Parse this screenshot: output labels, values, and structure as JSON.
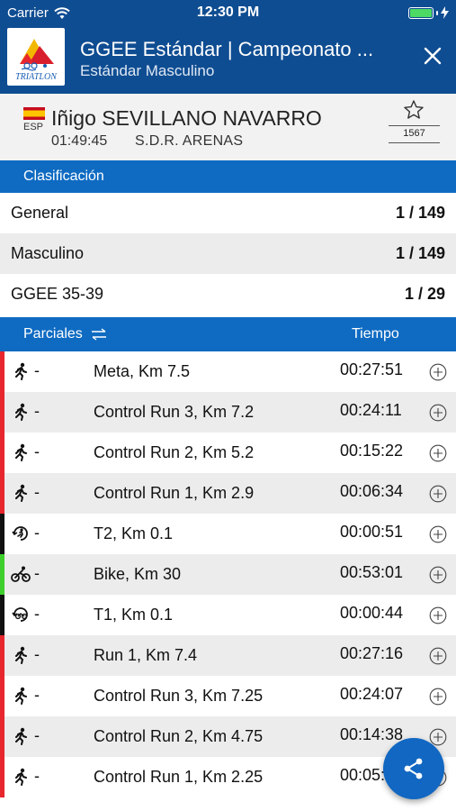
{
  "status_bar": {
    "carrier": "Carrier",
    "time": "12:30 PM"
  },
  "header": {
    "title": "GGEE Estándar | Campeonato ...",
    "subtitle": "Estándar Masculino",
    "logo_text": "TRIATLON"
  },
  "athlete": {
    "country": "ESP",
    "name": "Iñigo SEVILLANO NAVARRO",
    "time": "01:49:45",
    "club": "S.D.R. ARENAS",
    "bib": "1567"
  },
  "classification": {
    "heading": "Clasificación",
    "rows": [
      {
        "label": "General",
        "value": "1 / 149"
      },
      {
        "label": "Masculino",
        "value": "1 / 149"
      },
      {
        "label": "GGEE 35-39",
        "value": "1 / 29"
      }
    ]
  },
  "splits": {
    "heading": "Parciales",
    "time_heading": "Tiempo",
    "rows": [
      {
        "icon": "run-icon",
        "dash": "-",
        "name": "Meta, Km 7.5",
        "time": "00:27:51",
        "stripe": "#e8262e"
      },
      {
        "icon": "run-icon",
        "dash": "-",
        "name": "Control Run 3, Km 7.2",
        "time": "00:24:11",
        "stripe": "#e8262e"
      },
      {
        "icon": "run-icon",
        "dash": "-",
        "name": "Control Run 2, Km 5.2",
        "time": "00:15:22",
        "stripe": "#e8262e"
      },
      {
        "icon": "run-icon",
        "dash": "-",
        "name": "Control Run 1, Km 2.9",
        "time": "00:06:34",
        "stripe": "#e8262e"
      },
      {
        "icon": "transition-run-icon",
        "dash": "-",
        "name": "T2, Km 0.1",
        "time": "00:00:51",
        "stripe": "#111111"
      },
      {
        "icon": "bike-icon",
        "dash": "-",
        "name": "Bike, Km 30",
        "time": "00:53:01",
        "stripe": "#3ecf2c"
      },
      {
        "icon": "transition-bike-icon",
        "dash": "-",
        "name": "T1, Km 0.1",
        "time": "00:00:44",
        "stripe": "#111111"
      },
      {
        "icon": "run-icon",
        "dash": "-",
        "name": "Run 1, Km 7.4",
        "time": "00:27:16",
        "stripe": "#e8262e"
      },
      {
        "icon": "run-icon",
        "dash": "-",
        "name": "Control Run 3, Km 7.25",
        "time": "00:24:07",
        "stripe": "#e8262e"
      },
      {
        "icon": "run-icon",
        "dash": "-",
        "name": "Control Run 2, Km 4.75",
        "time": "00:14:38",
        "stripe": "#e8262e"
      },
      {
        "icon": "run-icon",
        "dash": "-",
        "name": "Control Run 1, Km 2.25",
        "time": "00:05:2",
        "stripe": "#e8262e"
      }
    ]
  },
  "colors": {
    "primary": "#0f4d92",
    "section": "#0f6bc2",
    "row_alt": "#ececec"
  },
  "fab": {
    "icon": "share-icon"
  }
}
